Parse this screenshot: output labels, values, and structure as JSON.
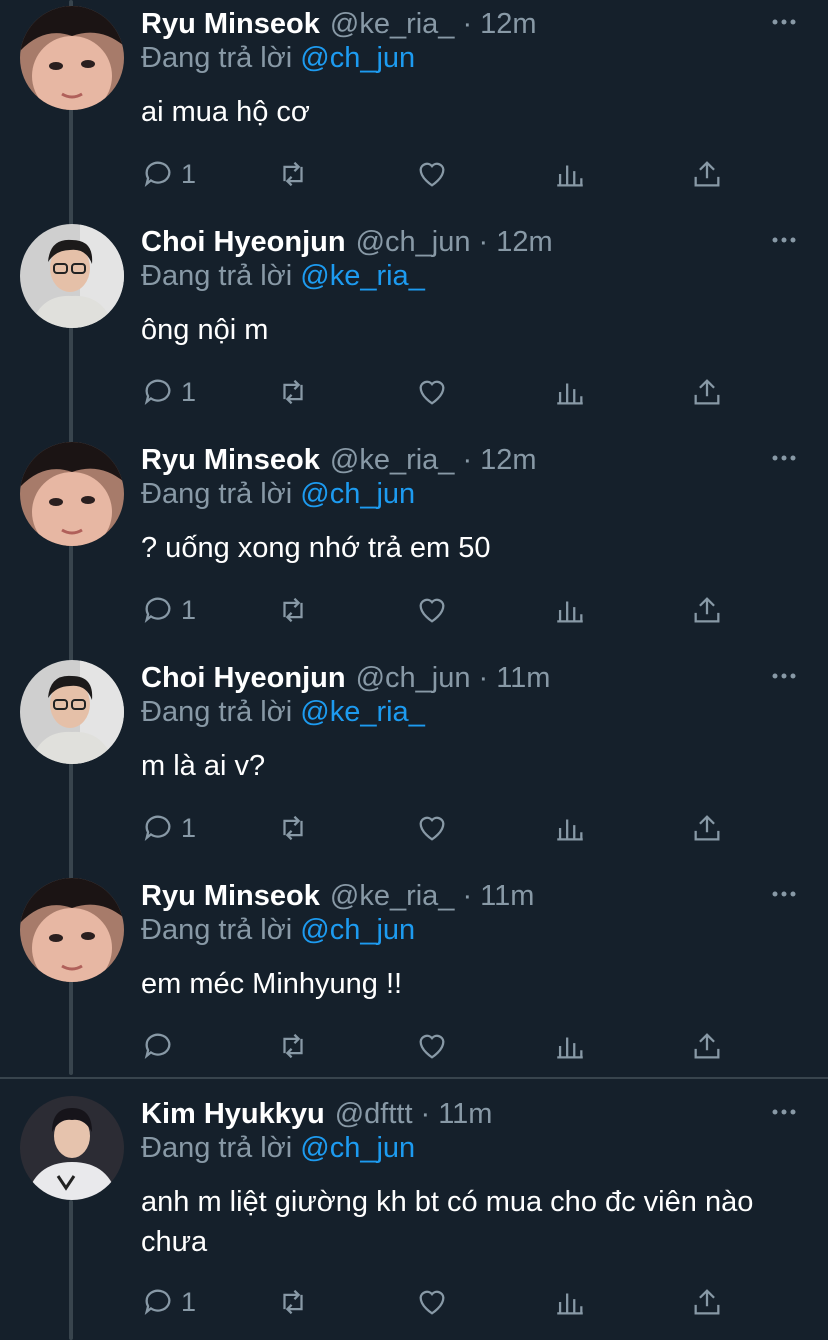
{
  "reply_prefix": "Đang trả lời",
  "colors": {
    "background": "#15202b",
    "mention": "#1d9bf0",
    "muted": "#8899a6",
    "text": "#ffffff"
  },
  "tweets": [
    {
      "name": "Ryu Minseok",
      "handle": "@ke_ria_",
      "time": "12m",
      "reply_to": "@ch_jun",
      "text": "ai mua hộ cơ",
      "reply_count": "1",
      "avatar": "dark-hair-closeup"
    },
    {
      "name": "Choi Hyeonjun",
      "handle": "@ch_jun",
      "time": "12m",
      "reply_to": "@ke_ria_",
      "text": "ông nội m",
      "reply_count": "1",
      "avatar": "glasses-light-jacket"
    },
    {
      "name": "Ryu Minseok",
      "handle": "@ke_ria_",
      "time": "12m",
      "reply_to": "@ch_jun",
      "text": "? uống xong nhớ trả em 50",
      "reply_count": "1",
      "avatar": "dark-hair-closeup"
    },
    {
      "name": "Choi Hyeonjun",
      "handle": "@ch_jun",
      "time": "11m",
      "reply_to": "@ke_ria_",
      "text": "m là ai v?",
      "reply_count": "1",
      "avatar": "glasses-light-jacket"
    },
    {
      "name": "Ryu Minseok",
      "handle": "@ke_ria_",
      "time": "11m",
      "reply_to": "@ch_jun",
      "text": "em méc Minhyung !!",
      "reply_count": "",
      "avatar": "dark-hair-closeup"
    },
    {
      "name": "Kim Hyukkyu",
      "handle": "@dfttt",
      "time": "11m",
      "reply_to": "@ch_jun",
      "text": "anh m liệt giường kh bt có mua cho đc viên nào chưa",
      "reply_count": "1",
      "avatar": "jersey-white"
    }
  ]
}
